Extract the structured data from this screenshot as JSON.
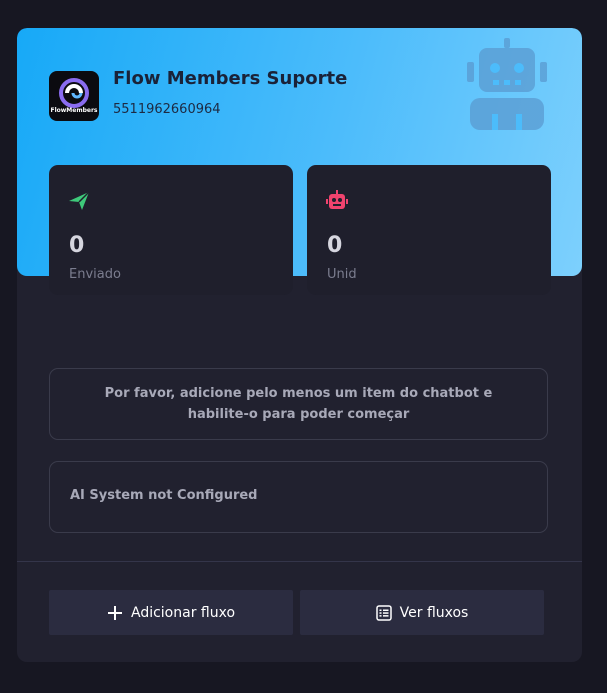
{
  "bot": {
    "name": "Flow Members Suporte",
    "phone": "5511962660964",
    "logo_text": "FlowMembers"
  },
  "stats": [
    {
      "value": "0",
      "label": "Enviado",
      "icon": "paper-plane-icon",
      "color": "#3ec97a"
    },
    {
      "value": "0",
      "label": "Unid",
      "icon": "robot-icon",
      "color": "#f0436e"
    }
  ],
  "notices": {
    "chatbot": "Por favor, adicione pelo menos um item do chatbot e habilite-o para poder começar",
    "ai": "AI System not Configured"
  },
  "actions": {
    "add_flow": "Adicionar fluxo",
    "view_flows": "Ver fluxos"
  },
  "colors": {
    "hero_start": "#17a9f7",
    "hero_end": "#7dd0fd",
    "card_bg": "#21212f",
    "page_bg": "#171722",
    "button_bg": "#2b2c40"
  }
}
